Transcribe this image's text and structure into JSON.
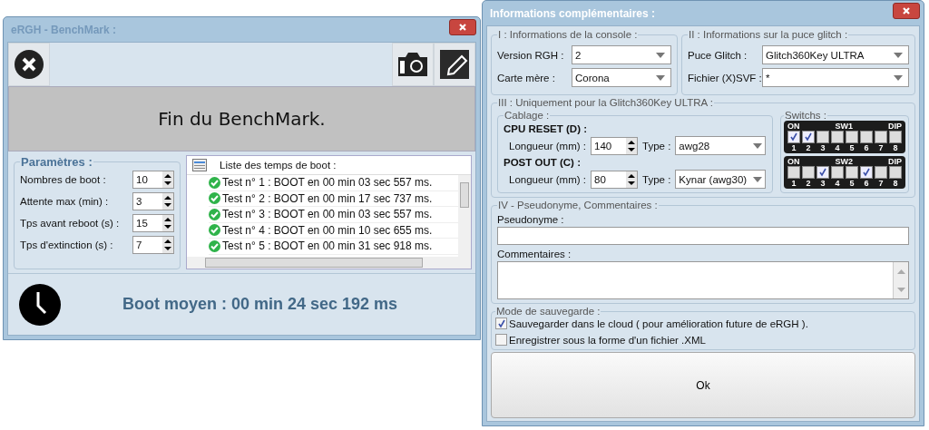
{
  "benchmark_window": {
    "title": "eRGH - BenchMark :",
    "banner": "Fin du BenchMark.",
    "parameters": {
      "title": "Paramètres :",
      "fields": [
        {
          "label": "Nombres de boot :",
          "value": "10"
        },
        {
          "label": "Attente max (min) :",
          "value": "3"
        },
        {
          "label": "Tps avant reboot (s) :",
          "value": "15"
        },
        {
          "label": "Tps d'extinction (s) :",
          "value": "7"
        }
      ]
    },
    "boot_list": {
      "title": "Liste des temps de boot :",
      "items": [
        "Test n° 1 : BOOT en 00 min 03 sec 557 ms.",
        "Test n° 2 : BOOT en 00 min 17 sec 737 ms.",
        "Test n° 3 : BOOT en 00 min 03 sec 557 ms.",
        "Test n° 4 : BOOT en 00 min 10 sec 655 ms.",
        "Test n° 5 : BOOT en 00 min 31 sec 918 ms."
      ]
    },
    "average": "Boot moyen : 00 min 24 sec 192 ms"
  },
  "info_window": {
    "title": "Informations complémentaires :",
    "console": {
      "title": "I : Informations de la console :",
      "fields": [
        {
          "label": "Version RGH :",
          "value": "2"
        },
        {
          "label": "Carte mère :",
          "value": "Corona"
        }
      ]
    },
    "glitch": {
      "title": "II : Informations sur la puce glitch :",
      "fields": [
        {
          "label": "Puce Glitch :",
          "value": "Glitch360Key ULTRA"
        },
        {
          "label": "Fichier (X)SVF :",
          "value": "*"
        }
      ]
    },
    "section3": {
      "title": "III : Uniquement pour la Glitch360Key ULTRA :",
      "cabling": {
        "title": "Cablage :",
        "groups": [
          {
            "heading": "CPU RESET (D) :",
            "length_label": "Longueur (mm) :",
            "length": "140",
            "type_label": "Type :",
            "type": "awg28"
          },
          {
            "heading": "POST OUT (C) :",
            "length_label": "Longueur (mm) :",
            "length": "80",
            "type_label": "Type :",
            "type": "Kynar (awg30)"
          }
        ]
      },
      "switchs": {
        "title": "Switchs :",
        "banks": [
          {
            "on_label": "ON",
            "name": "SW1",
            "dip_label": "DIP",
            "switches": [
              {
                "number": "1",
                "checked": true
              },
              {
                "number": "2",
                "checked": true
              },
              {
                "number": "3",
                "checked": false
              },
              {
                "number": "4",
                "checked": false
              },
              {
                "number": "5",
                "checked": false
              },
              {
                "number": "6",
                "checked": false
              },
              {
                "number": "7",
                "checked": false
              },
              {
                "number": "8",
                "checked": false
              }
            ]
          },
          {
            "on_label": "ON",
            "name": "SW2",
            "dip_label": "DIP",
            "switches": [
              {
                "number": "1",
                "checked": false
              },
              {
                "number": "2",
                "checked": false
              },
              {
                "number": "3",
                "checked": true
              },
              {
                "number": "4",
                "checked": false
              },
              {
                "number": "5",
                "checked": false
              },
              {
                "number": "6",
                "checked": true
              },
              {
                "number": "7",
                "checked": false
              },
              {
                "number": "8",
                "checked": false
              }
            ]
          }
        ]
      }
    },
    "section4": {
      "title": "IV - Pseudonyme, Commentaires :",
      "pseudo_label": "Pseudonyme :",
      "comments_label": "Commentaires :"
    },
    "save_mode": {
      "title": "Mode de sauvegarde :",
      "options": [
        {
          "label": "Sauvegarder dans le cloud ( pour amélioration future de eRGH ).",
          "checked": true
        },
        {
          "label": "Enregistrer sous la forme d'un fichier .XML",
          "checked": false
        }
      ]
    },
    "ok_button": "Ok"
  }
}
